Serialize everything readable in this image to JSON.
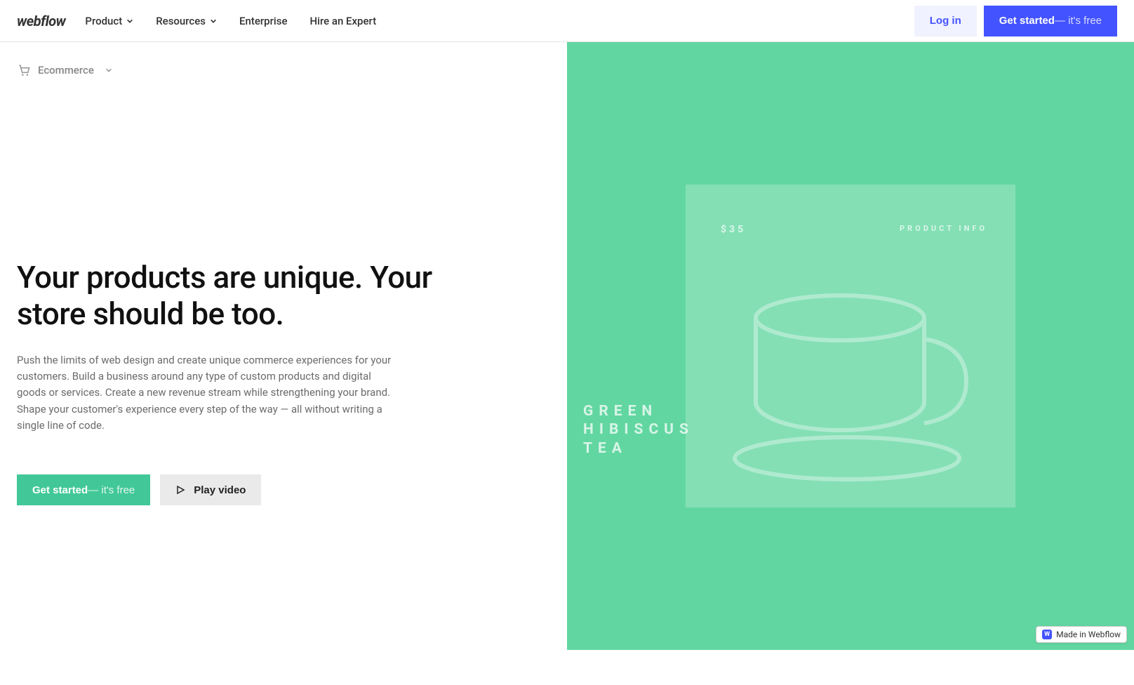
{
  "logo": "webflow",
  "nav": {
    "product": "Product",
    "resources": "Resources",
    "enterprise": "Enterprise",
    "hire": "Hire an Expert"
  },
  "auth": {
    "login": "Log in",
    "cta_bold": "Get started",
    "cta_rest": " — it's free"
  },
  "subnav": {
    "label": "Ecommerce"
  },
  "hero": {
    "title": "Your products are unique. Your store should be too.",
    "paragraph": "Push the limits of web design and create unique commerce experiences for your customers. Build a business around any type of custom products and digital goods or services. Create a new revenue stream while strengthening your brand. Shape your customer's experience every step of the way — all without writing a single line of code.",
    "cta_bold": "Get started",
    "cta_rest": " — it's free",
    "play": "Play video"
  },
  "product_card": {
    "price": "$35",
    "info_label": "PRODUCT INFO",
    "name_line1": "GREEN",
    "name_line2": "HIBISCUS",
    "name_line3": "TEA"
  },
  "badge": {
    "text": "Made in Webflow",
    "logo": "W"
  }
}
